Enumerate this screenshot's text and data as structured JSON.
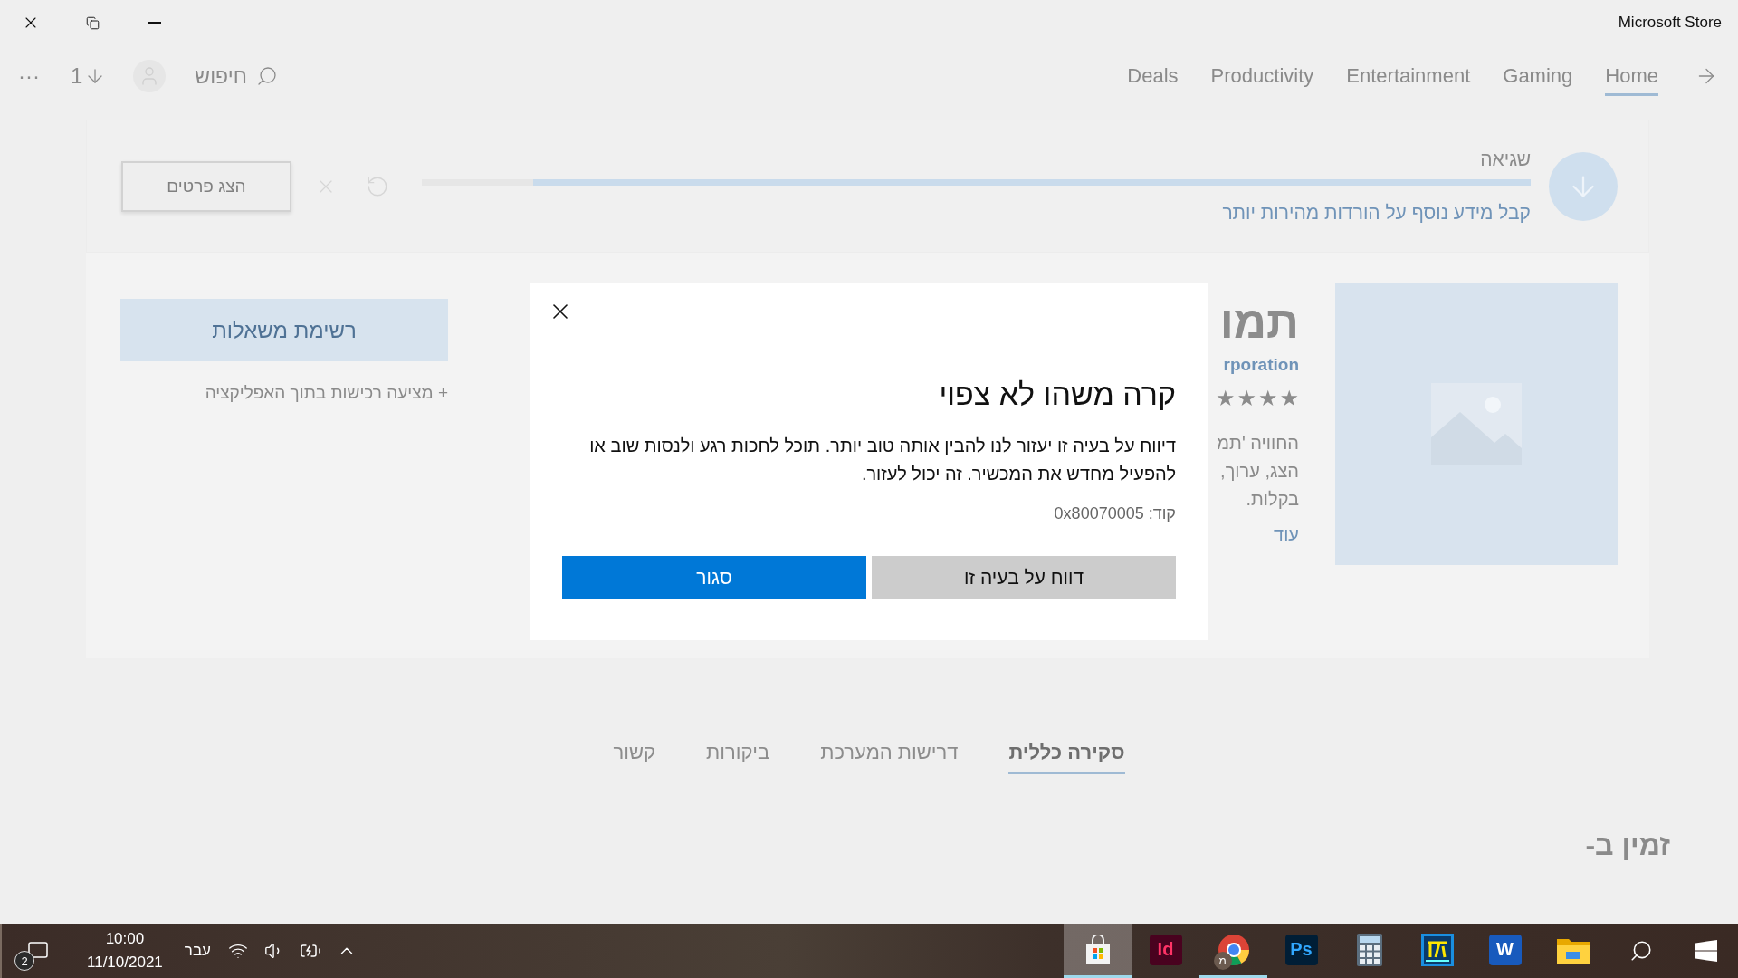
{
  "window": {
    "title": "Microsoft Store"
  },
  "nav": {
    "more": "···",
    "downloads_count": "1",
    "search_label": "חיפוש",
    "items": [
      {
        "label": "Home",
        "selected": true
      },
      {
        "label": "Gaming",
        "selected": false
      },
      {
        "label": "Entertainment",
        "selected": false
      },
      {
        "label": "Productivity",
        "selected": false
      },
      {
        "label": "Deals",
        "selected": false
      }
    ]
  },
  "download": {
    "status": "שגיאה",
    "level": 0.9,
    "info_link": "קבל מידע נוסף על הורדות מהירות יותר",
    "details_button": "הצג פרטים"
  },
  "app": {
    "title": "תמו",
    "publisher": "rporation",
    "stars": 4,
    "description_lines": [
      "החוויה 'תמ",
      "הצג, ערוך,",
      "בקלות."
    ],
    "more_link": "עוד",
    "wishlist_button": "רשימת משאלות",
    "in_app_purchases": "+ מציעה רכישות בתוך האפליקציה"
  },
  "dialog": {
    "title": "קרה משהו לא צפוי",
    "message": "דיווח על בעיה זו יעזור לנו להבין אותה טוב יותר. תוכל לחכות רגע ולנסות שוב או להפעיל מחדש את המכשיר. זה יכול לעזור.",
    "code": "קוד: 0x80070005",
    "buttons": [
      {
        "label": "דווח על בעיה זו",
        "kind": "secondary"
      },
      {
        "label": "סגור",
        "kind": "primary"
      }
    ]
  },
  "tabs": [
    {
      "label": "סקירה כללית",
      "selected": true
    },
    {
      "label": "דרישות המערכת",
      "selected": false
    },
    {
      "label": "ביקורות",
      "selected": false
    },
    {
      "label": "קשור",
      "selected": false
    }
  ],
  "available_heading": "זמין ב-",
  "taskbar": {
    "notifications_count": "2",
    "time": "10:00",
    "date": "11/10/2021",
    "language": "עבר",
    "apps": [
      {
        "kind": "explorer",
        "selected": false,
        "running": false
      },
      {
        "kind": "word",
        "label": "W",
        "selected": false,
        "running": false
      },
      {
        "kind": "app",
        "selected": false,
        "running": false
      },
      {
        "kind": "calculator",
        "selected": false,
        "running": false
      },
      {
        "kind": "photoshop",
        "label": "Ps",
        "selected": false,
        "running": false
      },
      {
        "kind": "chrome",
        "badge": "מ",
        "selected": false,
        "running": true
      },
      {
        "kind": "indesign",
        "label": "Id",
        "selected": false,
        "running": false
      },
      {
        "kind": "store",
        "selected": true,
        "running": true
      }
    ]
  }
}
